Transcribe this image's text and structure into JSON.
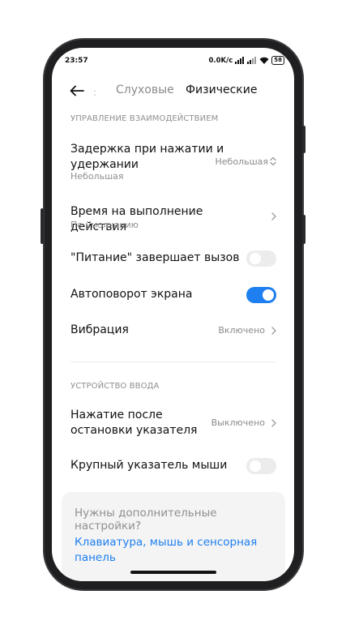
{
  "status_bar": {
    "time": "23:57",
    "net_speed": "0.0K/с",
    "battery": "58"
  },
  "header": {
    "tab_separator": ":",
    "tabs": [
      {
        "label": "Слуховые",
        "active": false
      },
      {
        "label": "Физические",
        "active": true
      }
    ]
  },
  "sections": {
    "interaction": {
      "title": "УПРАВЛЕНИЕ ВЗАИМОДЕЙСТВИЕМ",
      "items": {
        "tap_delay": {
          "title": "Задержка при нажатии и удержании",
          "subtitle": "Небольшая",
          "value": "Небольшая"
        },
        "action_time": {
          "title": "Время на выполнение действия",
          "subtitle": "По умолчанию"
        },
        "power_ends_call": {
          "title": "\"Питание\" завершает вызов",
          "enabled": false
        },
        "auto_rotate": {
          "title": "Автоповорот экрана",
          "enabled": true
        },
        "vibration": {
          "title": "Вибрация",
          "value": "Включено"
        }
      }
    },
    "input_device": {
      "title": "УСТРОЙСТВО ВВОДА",
      "items": {
        "click_after_stop": {
          "title": "Нажатие после остановки указателя",
          "value": "Выключено"
        },
        "large_pointer": {
          "title": "Крупный указатель мыши",
          "enabled": false
        }
      }
    }
  },
  "help": {
    "question": "Нужны дополнительные настройки?",
    "link": "Клавиатура, мышь и сенсорная панель"
  },
  "colors": {
    "accent": "#1e7ff0",
    "toggle_off": "#ececec",
    "secondary_text": "#8f8f8f"
  }
}
